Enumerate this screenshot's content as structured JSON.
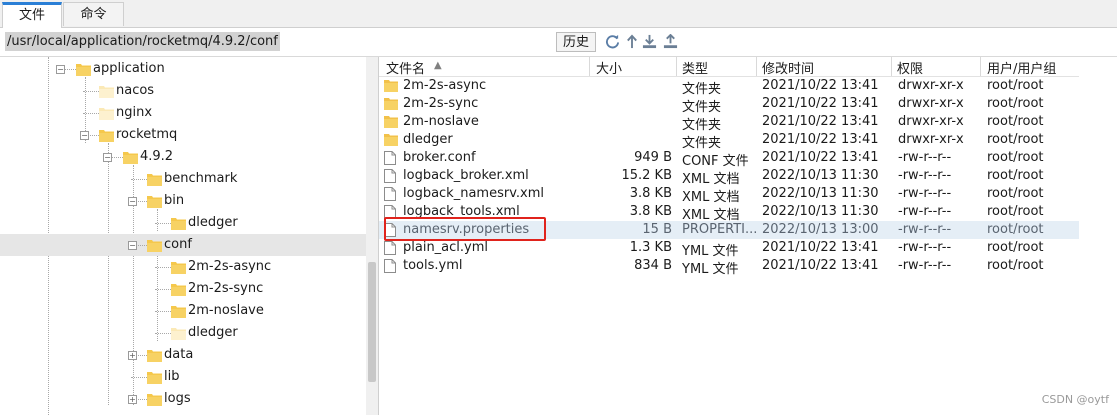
{
  "tabs": [
    {
      "label": "文件",
      "active": true
    },
    {
      "label": "命令",
      "active": false
    }
  ],
  "path": {
    "value": "/usr/local/application/rocketmq/4.9.2/conf"
  },
  "toolbar": {
    "history_label": "历史",
    "icons": [
      "refresh-icon",
      "up-arrow-icon",
      "download-icon",
      "upload-icon"
    ]
  },
  "tree": {
    "items": [
      {
        "label": "application",
        "depth": 2,
        "expand": "minus"
      },
      {
        "label": "nacos",
        "depth": 3,
        "expand": "none"
      },
      {
        "label": "nginx",
        "depth": 3,
        "expand": "none"
      },
      {
        "label": "rocketmq",
        "depth": 3,
        "expand": "minus"
      },
      {
        "label": "4.9.2",
        "depth": 4,
        "expand": "minus"
      },
      {
        "label": "benchmark",
        "depth": 5,
        "expand": "none"
      },
      {
        "label": "bin",
        "depth": 5,
        "expand": "minus"
      },
      {
        "label": "dledger",
        "depth": 6,
        "expand": "none"
      },
      {
        "label": "conf",
        "depth": 5,
        "expand": "minus",
        "selected": true
      },
      {
        "label": "2m-2s-async",
        "depth": 6,
        "expand": "none"
      },
      {
        "label": "2m-2s-sync",
        "depth": 6,
        "expand": "none"
      },
      {
        "label": "2m-noslave",
        "depth": 6,
        "expand": "none"
      },
      {
        "label": "dledger",
        "depth": 6,
        "expand": "none"
      },
      {
        "label": "data",
        "depth": 5,
        "expand": "plus"
      },
      {
        "label": "lib",
        "depth": 5,
        "expand": "none"
      },
      {
        "label": "logs",
        "depth": 5,
        "expand": "plus"
      }
    ]
  },
  "list": {
    "columns": [
      "文件名",
      "大小",
      "类型",
      "修改时间",
      "权限",
      "用户/用户组"
    ],
    "sort_indicator": "▲",
    "rows": [
      {
        "name": "2m-2s-async",
        "size": "",
        "type": "文件夹",
        "mtime": "2021/10/22 13:41",
        "perm": "drwxr-xr-x",
        "owner": "root/root",
        "kind": "folder"
      },
      {
        "name": "2m-2s-sync",
        "size": "",
        "type": "文件夹",
        "mtime": "2021/10/22 13:41",
        "perm": "drwxr-xr-x",
        "owner": "root/root",
        "kind": "folder"
      },
      {
        "name": "2m-noslave",
        "size": "",
        "type": "文件夹",
        "mtime": "2021/10/22 13:41",
        "perm": "drwxr-xr-x",
        "owner": "root/root",
        "kind": "folder"
      },
      {
        "name": "dledger",
        "size": "",
        "type": "文件夹",
        "mtime": "2021/10/22 13:41",
        "perm": "drwxr-xr-x",
        "owner": "root/root",
        "kind": "folder"
      },
      {
        "name": "broker.conf",
        "size": "949 B",
        "type": "CONF 文件",
        "mtime": "2021/10/22 13:41",
        "perm": "-rw-r--r--",
        "owner": "root/root",
        "kind": "file"
      },
      {
        "name": "logback_broker.xml",
        "size": "15.2 KB",
        "type": "XML 文档",
        "mtime": "2022/10/13 11:30",
        "perm": "-rw-r--r--",
        "owner": "root/root",
        "kind": "file"
      },
      {
        "name": "logback_namesrv.xml",
        "size": "3.8 KB",
        "type": "XML 文档",
        "mtime": "2022/10/13 11:30",
        "perm": "-rw-r--r--",
        "owner": "root/root",
        "kind": "file"
      },
      {
        "name": "logback_tools.xml",
        "size": "3.8 KB",
        "type": "XML 文档",
        "mtime": "2022/10/13 11:30",
        "perm": "-rw-r--r--",
        "owner": "root/root",
        "kind": "file"
      },
      {
        "name": "namesrv.properties",
        "size": "15 B",
        "type": "PROPERTI...",
        "mtime": "2022/10/13 13:00",
        "perm": "-rw-r--r--",
        "owner": "root/root",
        "kind": "file",
        "highlight": true
      },
      {
        "name": "plain_acl.yml",
        "size": "1.3 KB",
        "type": "YML 文件",
        "mtime": "2021/10/22 13:41",
        "perm": "-rw-r--r--",
        "owner": "root/root",
        "kind": "file"
      },
      {
        "name": "tools.yml",
        "size": "834 B",
        "type": "YML 文件",
        "mtime": "2021/10/22 13:41",
        "perm": "-rw-r--r--",
        "owner": "root/root",
        "kind": "file"
      }
    ]
  },
  "watermark": "CSDN @oytf",
  "colors": {
    "accent": "#2a7fd6",
    "folder": "#f5c84c",
    "highlight_box": "#e0231c",
    "selected_row": "#e5eef6"
  }
}
